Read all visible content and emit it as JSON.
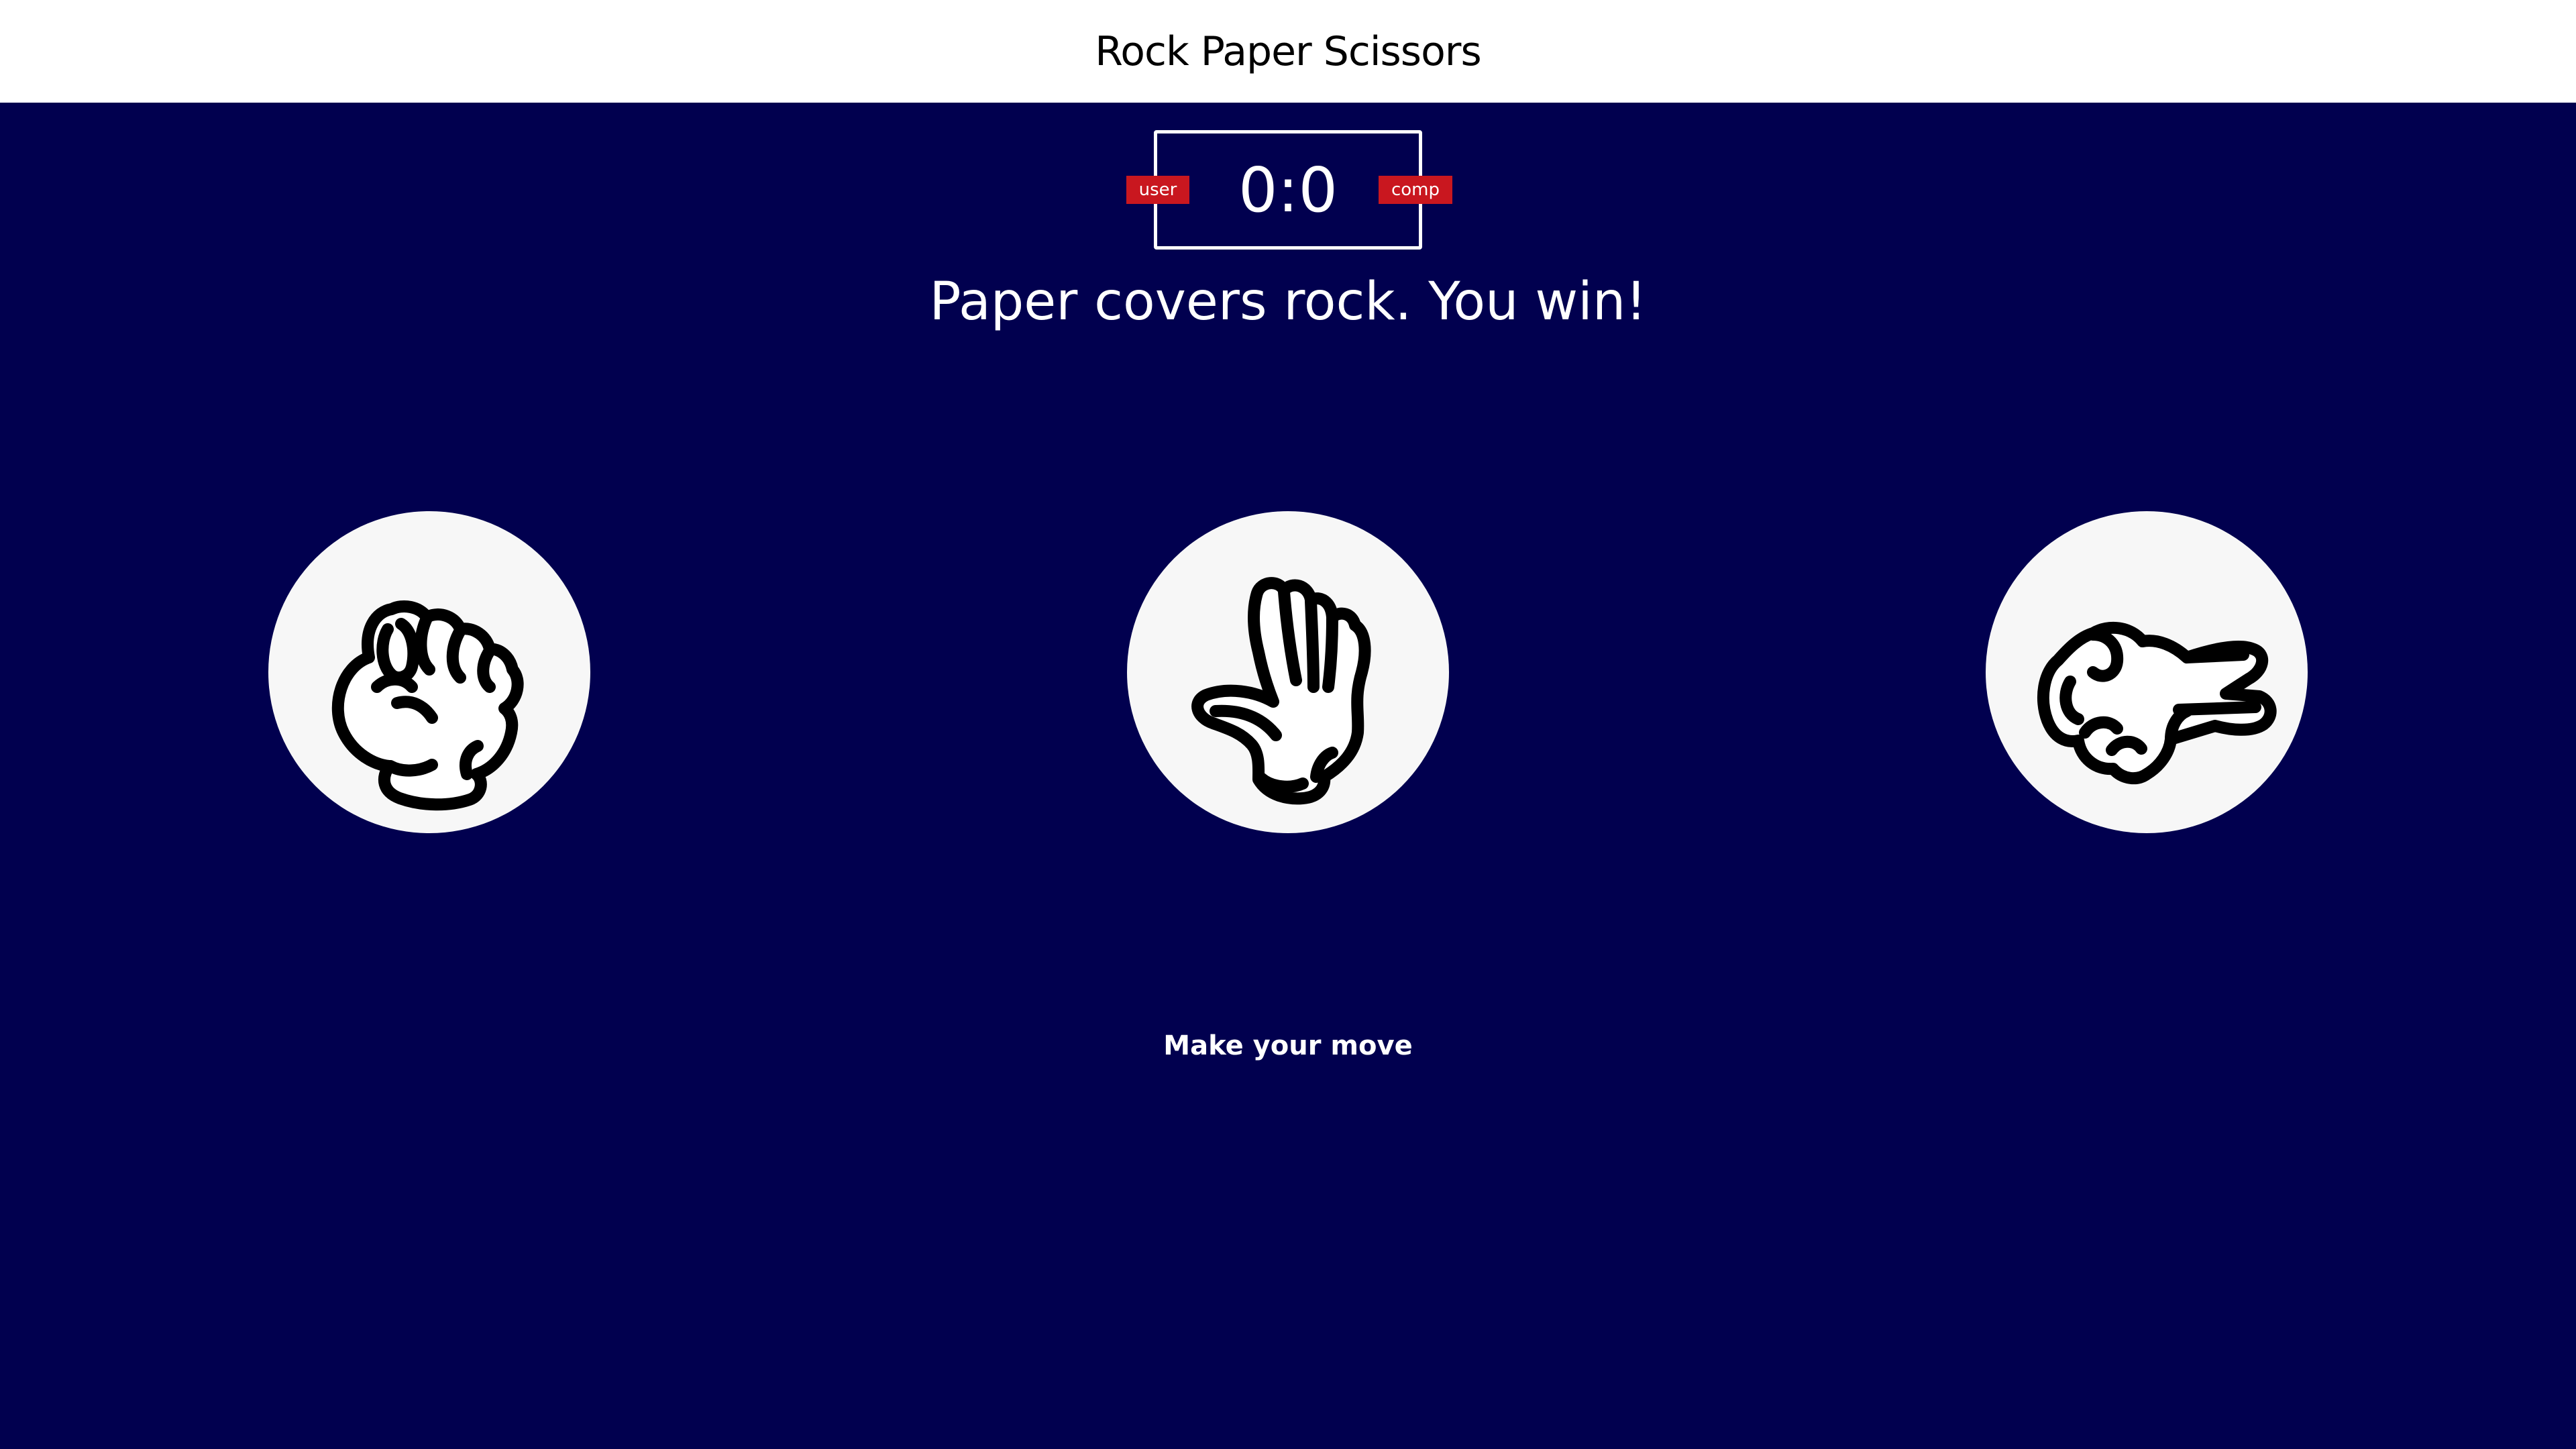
{
  "header": {
    "title": "Rock Paper Scissors"
  },
  "scoreboard": {
    "score": "0:0",
    "user_label": "user",
    "comp_label": "comp"
  },
  "result_message": "Paper covers rock. You win!",
  "choices": [
    {
      "id": "rock",
      "icon": "rock-hand-icon"
    },
    {
      "id": "paper",
      "icon": "paper-hand-icon"
    },
    {
      "id": "scissors",
      "icon": "scissors-hand-icon"
    }
  ],
  "prompt": "Make your move",
  "colors": {
    "background": "#01004f",
    "header_bg": "#ffffff",
    "badge": "#c9171f",
    "choice_bg": "#f7f7f7"
  }
}
